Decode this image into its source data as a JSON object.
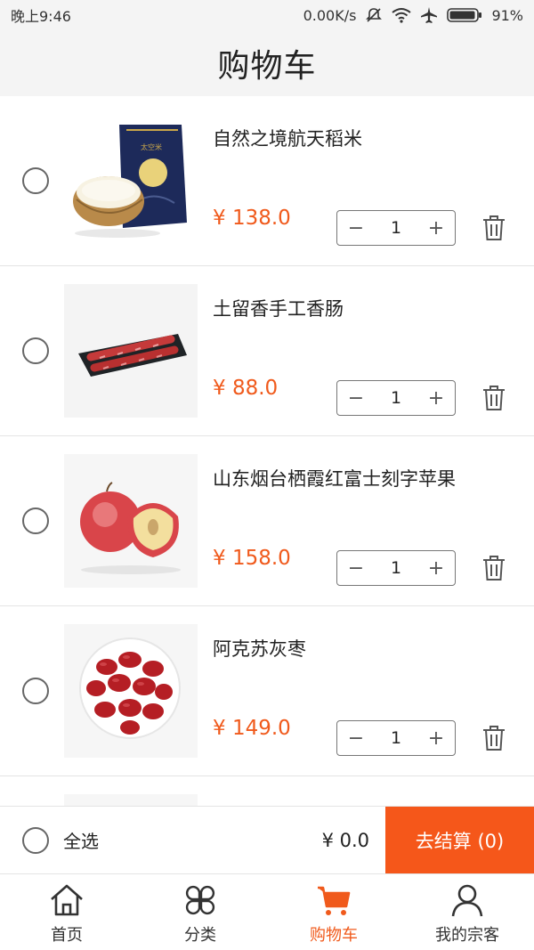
{
  "status_bar": {
    "time": "晚上9:46",
    "network_speed": "0.00K/s",
    "battery": "91%"
  },
  "header": {
    "title": "购物车"
  },
  "cart": {
    "items": [
      {
        "name": "自然之境航天稻米",
        "price": "¥ 138.0",
        "quantity": "1",
        "image_icon": "rice-bag-image"
      },
      {
        "name": "土留香手工香肠",
        "price": "¥ 88.0",
        "quantity": "1",
        "image_icon": "sausage-image"
      },
      {
        "name": "山东烟台栖霞红富士刻字苹果",
        "price": "¥ 158.0",
        "quantity": "1",
        "image_icon": "apple-image"
      },
      {
        "name": "阿克苏灰枣",
        "price": "¥ 149.0",
        "quantity": "1",
        "image_icon": "jujube-image"
      }
    ],
    "minus_label": "−",
    "plus_label": "+"
  },
  "summary": {
    "select_all_label": "全选",
    "total": "¥ 0.0",
    "checkout_label": "去结算 (0)"
  },
  "tabs": [
    {
      "label": "首页",
      "icon": "home-icon",
      "active": false
    },
    {
      "label": "分类",
      "icon": "category-icon",
      "active": false
    },
    {
      "label": "购物车",
      "icon": "cart-icon",
      "active": true
    },
    {
      "label": "我的宗客",
      "icon": "profile-icon",
      "active": false
    }
  ],
  "colors": {
    "accent": "#f05a1c",
    "checkout_bg": "#f5571a"
  }
}
